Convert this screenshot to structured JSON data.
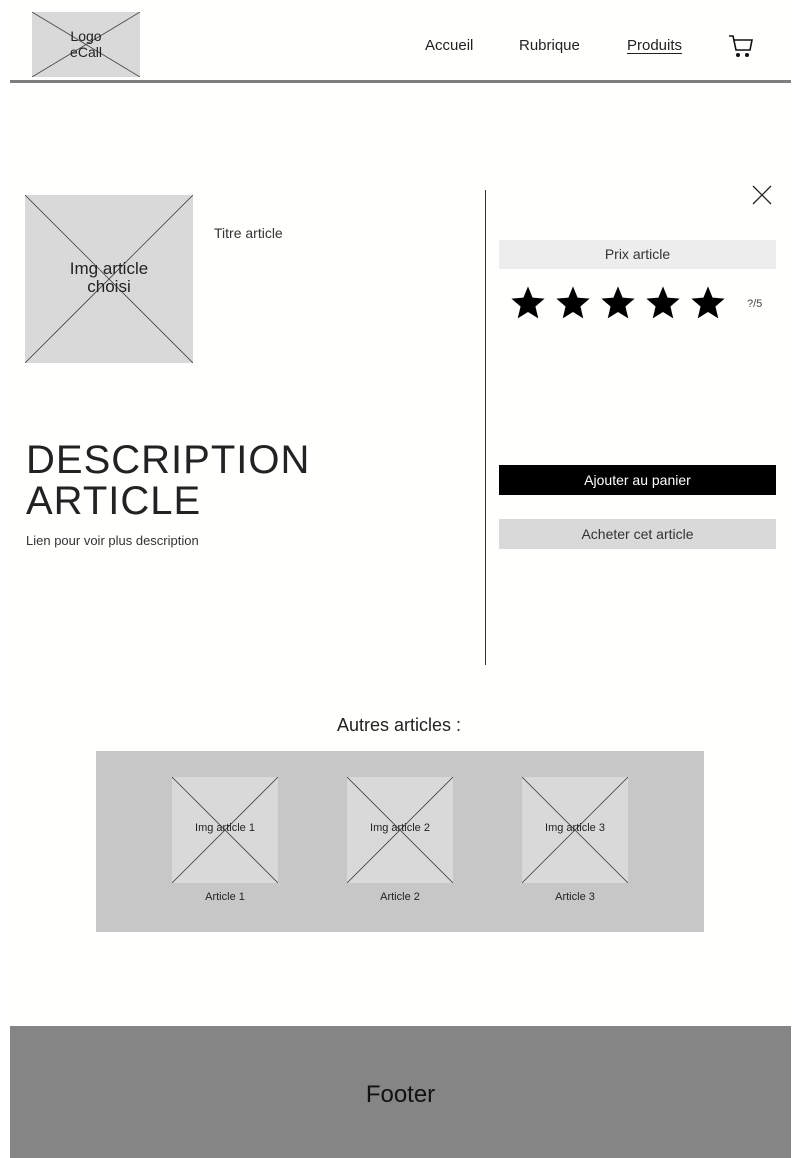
{
  "header": {
    "logo_text": "Logo\neCall",
    "nav": [
      {
        "label": "Accueil"
      },
      {
        "label": "Rubrique"
      },
      {
        "label": "Produits",
        "active": true
      }
    ],
    "cart_icon": "cart-icon"
  },
  "product": {
    "image_placeholder": "Img article choisi",
    "title": "Titre article",
    "price_label": "Prix article",
    "rating": {
      "stars_total": 5,
      "stars_filled": 5,
      "text": "?/5"
    },
    "description_title": "DESCRIPTION\nARTICLE",
    "description_link": "Lien pour voir plus description",
    "add_to_cart_label": "Ajouter au panier",
    "buy_label": "Acheter cet article",
    "close_icon": "close-icon"
  },
  "others": {
    "title": "Autres articles :",
    "items": [
      {
        "image_placeholder": "Img article 1",
        "label": "Article 1"
      },
      {
        "image_placeholder": "Img article 2",
        "label": "Article 2"
      },
      {
        "image_placeholder": "Img article 3",
        "label": "Article 3"
      }
    ]
  },
  "footer": {
    "label": "Footer"
  },
  "colors": {
    "placeholder": "#d9d9d9",
    "panel": "#c7c7c7",
    "footer": "#858585",
    "primary_button": "#000000"
  }
}
